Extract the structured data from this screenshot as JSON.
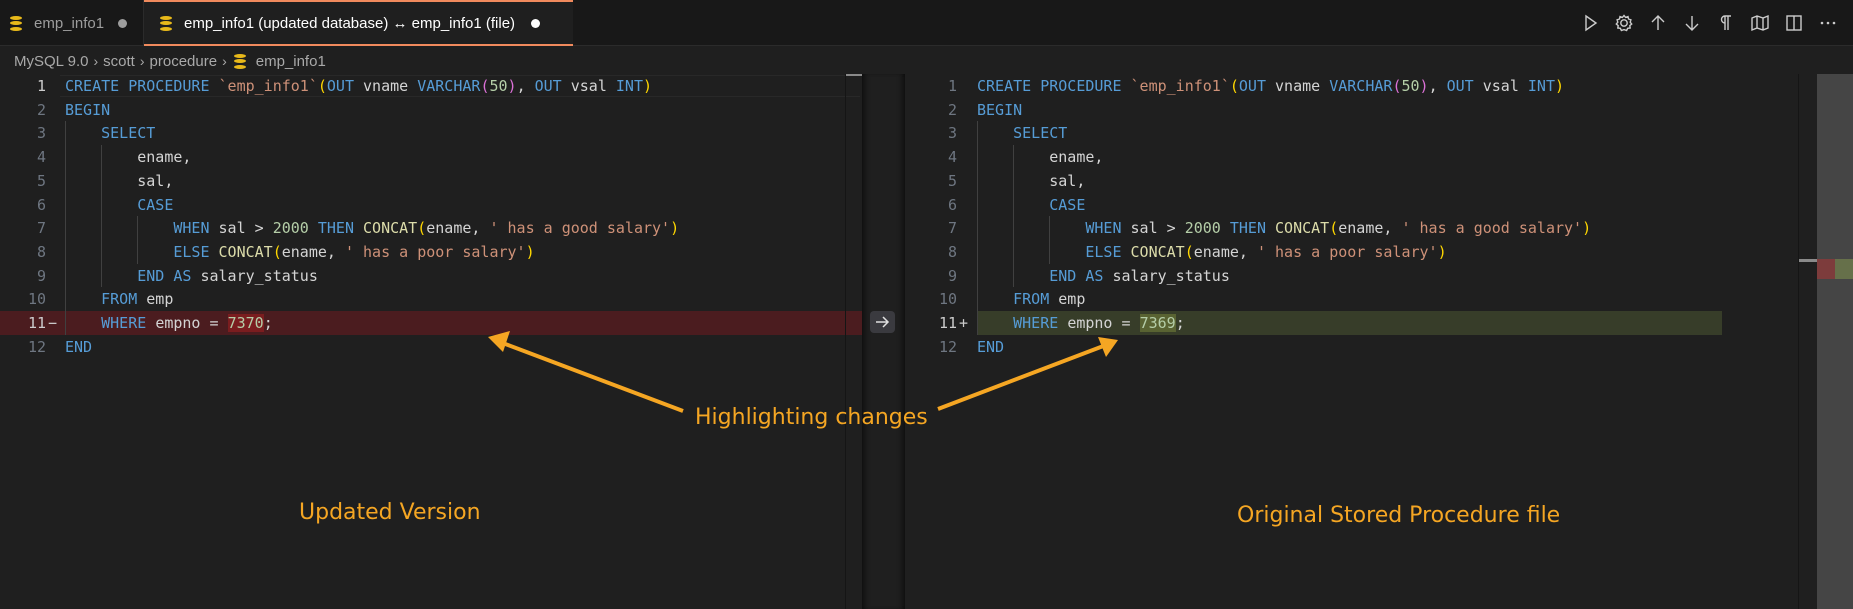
{
  "tabs": [
    {
      "label": "emp_info1",
      "icon": "database-icon",
      "dirty": true,
      "active": false
    },
    {
      "label": "emp_info1 (updated database) ↔ emp_info1 (file)",
      "icon": "database-icon",
      "dirty": true,
      "active": true
    }
  ],
  "toolbar": {
    "actions": [
      {
        "name": "run-icon",
        "title": "Run"
      },
      {
        "name": "gear-icon",
        "title": "Settings"
      },
      {
        "name": "arrow-up-icon",
        "title": "Previous Change"
      },
      {
        "name": "arrow-down-icon",
        "title": "Next Change"
      },
      {
        "name": "pilcrow-icon",
        "title": "Show Whitespace"
      },
      {
        "name": "map-icon",
        "title": "Toggle Minimap"
      },
      {
        "name": "split-editor-icon",
        "title": "Split Editor"
      },
      {
        "name": "more-icon",
        "title": "More Actions"
      }
    ]
  },
  "breadcrumb": {
    "items": [
      "MySQL 9.0",
      "scott",
      "procedure",
      "emp_info1"
    ],
    "separator": "›"
  },
  "diff": {
    "left_label": "updated database",
    "right_label": "file",
    "left_lines": [
      {
        "n": "1",
        "text": "CREATE PROCEDURE `emp_info1`(OUT vname VARCHAR(50), OUT vsal INT)"
      },
      {
        "n": "2",
        "text": "BEGIN"
      },
      {
        "n": "3",
        "text": "    SELECT"
      },
      {
        "n": "4",
        "text": "        ename,"
      },
      {
        "n": "5",
        "text": "        sal,"
      },
      {
        "n": "6",
        "text": "        CASE"
      },
      {
        "n": "7",
        "text": "            WHEN sal > 2000 THEN CONCAT(ename, ' has a good salary')"
      },
      {
        "n": "8",
        "text": "            ELSE CONCAT(ename, ' has a poor salary')"
      },
      {
        "n": "9",
        "text": "        END AS salary_status"
      },
      {
        "n": "10",
        "text": "    FROM emp"
      },
      {
        "n": "11",
        "text": "    WHERE empno = 7370;",
        "change": "removed",
        "marker": "−",
        "changed_value": "7370"
      },
      {
        "n": "12",
        "text": "END"
      }
    ],
    "right_lines": [
      {
        "n": "1",
        "text": "CREATE PROCEDURE `emp_info1`(OUT vname VARCHAR(50), OUT vsal INT)"
      },
      {
        "n": "2",
        "text": "BEGIN"
      },
      {
        "n": "3",
        "text": "    SELECT"
      },
      {
        "n": "4",
        "text": "        ename,"
      },
      {
        "n": "5",
        "text": "        sal,"
      },
      {
        "n": "6",
        "text": "        CASE"
      },
      {
        "n": "7",
        "text": "            WHEN sal > 2000 THEN CONCAT(ename, ' has a good salary')"
      },
      {
        "n": "8",
        "text": "            ELSE CONCAT(ename, ' has a poor salary')"
      },
      {
        "n": "9",
        "text": "        END AS salary_status"
      },
      {
        "n": "10",
        "text": "    FROM emp"
      },
      {
        "n": "11",
        "text": "    WHERE empno = 7369;",
        "change": "added",
        "marker": "+",
        "changed_value": "7369"
      },
      {
        "n": "12",
        "text": "END"
      }
    ],
    "revert_button": {
      "icon": "arrow-right-icon",
      "title": "Revert Block"
    }
  },
  "annotations": {
    "center": "Highlighting changes",
    "left": "Updated Version",
    "right": "Original Stored Procedure file",
    "color": "#f5a623"
  },
  "colors": {
    "accent_tab_border": "#f08a5d",
    "removed_line": "#4b1c1f",
    "added_line": "#373d29",
    "keyword": "#569cd6",
    "string": "#ce9178",
    "number": "#b5cea8",
    "function": "#dcdcaa"
  }
}
